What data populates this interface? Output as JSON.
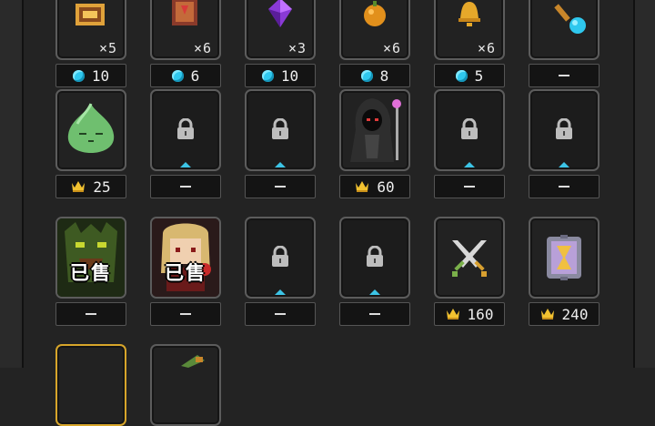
{
  "row0": [
    {
      "icon": "treasure-map-icon",
      "qty": "×5",
      "currency": "gem",
      "price": "10"
    },
    {
      "icon": "spellbook-icon",
      "qty": "×6",
      "currency": "gem",
      "price": "6"
    },
    {
      "icon": "purple-crystal-icon",
      "qty": "×3",
      "currency": "gem",
      "price": "10"
    },
    {
      "icon": "orange-fruit-icon",
      "qty": "×6",
      "currency": "gem",
      "price": "8"
    },
    {
      "icon": "golden-bell-icon",
      "qty": "×6",
      "currency": "gem",
      "price": "5"
    },
    {
      "icon": "blue-orb-wand-icon",
      "qty": "",
      "currency": "none",
      "price": "—"
    }
  ],
  "row1": [
    {
      "icon": "green-slime-icon",
      "currency": "crown",
      "price": "25"
    },
    {
      "icon": "lock-icon",
      "currency": "none",
      "price": "—"
    },
    {
      "icon": "lock-icon",
      "currency": "none",
      "price": "—"
    },
    {
      "icon": "hooded-reaper-icon",
      "currency": "crown",
      "price": "60"
    },
    {
      "icon": "lock-icon",
      "currency": "none",
      "price": "—"
    },
    {
      "icon": "lock-icon",
      "currency": "none",
      "price": "—"
    }
  ],
  "row2": [
    {
      "icon": "tree-ent-icon",
      "sold": "已售",
      "currency": "none",
      "price": "—"
    },
    {
      "icon": "blonde-girl-icon",
      "sold": "已售",
      "currency": "none",
      "price": "—"
    },
    {
      "icon": "lock-icon",
      "currency": "none",
      "price": "—"
    },
    {
      "icon": "lock-icon",
      "currency": "none",
      "price": "—"
    },
    {
      "icon": "crossed-swords-icon",
      "currency": "crown",
      "price": "160"
    },
    {
      "icon": "hourglass-frame-icon",
      "currency": "crown",
      "price": "240"
    }
  ],
  "colors": {
    "gem": "#2fc8ee",
    "crown": "#f2c230",
    "accent_gold_border": "#d7a52a"
  }
}
